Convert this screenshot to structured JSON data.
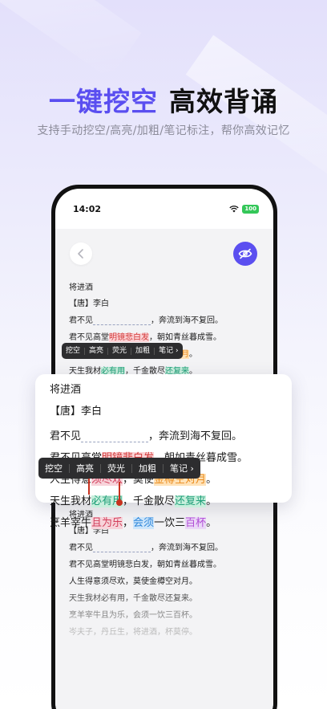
{
  "headline": {
    "accent": "一键挖空",
    "main": "高效背诵"
  },
  "subline": "支持手动挖空/高亮/加粗/笔记标注，帮你高效记忆",
  "status": {
    "time": "14:02",
    "battery": "100"
  },
  "colors": {
    "accent": "#5b4ff0"
  },
  "poem_top": {
    "title": "将进酒",
    "author": "【唐】李白",
    "line1": {
      "a": "君不见",
      "b": "，奔流到海不复回。"
    },
    "line2": {
      "a": "君不见高堂",
      "hl": "明镜悲白发",
      "b": "，朝如青丝暮成雪。"
    },
    "line3": {
      "a": "人生得意",
      "hl1": "须尽欢",
      "b": "，莫使",
      "hl2": "金樽空对月",
      "c": "。"
    },
    "line4": {
      "a": "天生我材",
      "hl1": "必有用",
      "b": "，千金散尽",
      "hl2": "还复来",
      "c": "。"
    },
    "line5": {
      "a": "烹羊宰牛",
      "hl1": "且为乐",
      "b": "，",
      "hl2": "会须",
      "c": "一饮三",
      "hl3": "百杯",
      "d": "。"
    }
  },
  "menu": {
    "items": [
      "挖空",
      "高亮",
      "荧光",
      "加粗"
    ],
    "note": "笔记"
  },
  "poem_bottom": {
    "title": "将进酒",
    "author": "【唐】李白",
    "line1": {
      "a": "君不见",
      "b": "，奔流到海不复回。"
    },
    "line2": "君不见高堂明镜悲白发，朝如青丝暮成雪。",
    "line3": "人生得意须尽欢，莫使金樽空对月。",
    "line4": "天生我材必有用，千金散尽还复来。",
    "line5": "烹羊宰牛且为乐，会须一饮三百杯。",
    "line6": "岑夫子，丹丘生，将进酒，杯莫停。"
  }
}
